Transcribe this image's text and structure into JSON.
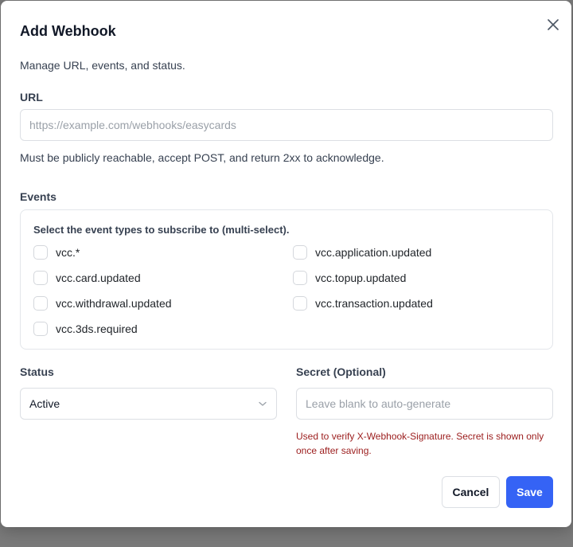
{
  "dialog": {
    "title": "Add Webhook",
    "subtitle": "Manage URL, events, and status."
  },
  "url": {
    "label": "URL",
    "value": "",
    "placeholder": "https://example.com/webhooks/easycards",
    "help": "Must be publicly reachable, accept POST, and return 2xx to acknowledge."
  },
  "events": {
    "label": "Events",
    "hint": "Select the event types to subscribe to (multi-select).",
    "items": [
      {
        "label": "vcc.*",
        "checked": false
      },
      {
        "label": "vcc.application.updated",
        "checked": false
      },
      {
        "label": "vcc.card.updated",
        "checked": false
      },
      {
        "label": "vcc.topup.updated",
        "checked": false
      },
      {
        "label": "vcc.withdrawal.updated",
        "checked": false
      },
      {
        "label": "vcc.transaction.updated",
        "checked": false
      },
      {
        "label": "vcc.3ds.required",
        "checked": false
      }
    ]
  },
  "status": {
    "label": "Status",
    "selected": "Active"
  },
  "secret": {
    "label": "Secret (Optional)",
    "value": "",
    "placeholder": "Leave blank to auto-generate",
    "help": "Used to verify X-Webhook-Signature. Secret is shown only once after saving."
  },
  "actions": {
    "cancel_label": "Cancel",
    "save_label": "Save"
  },
  "colors": {
    "primary": "#3563f5",
    "warning_text": "#9b1c1c",
    "overlay": "#7a7a7a"
  },
  "icons": {
    "close": "close-icon",
    "dropdown": "chevron-down-icon"
  }
}
